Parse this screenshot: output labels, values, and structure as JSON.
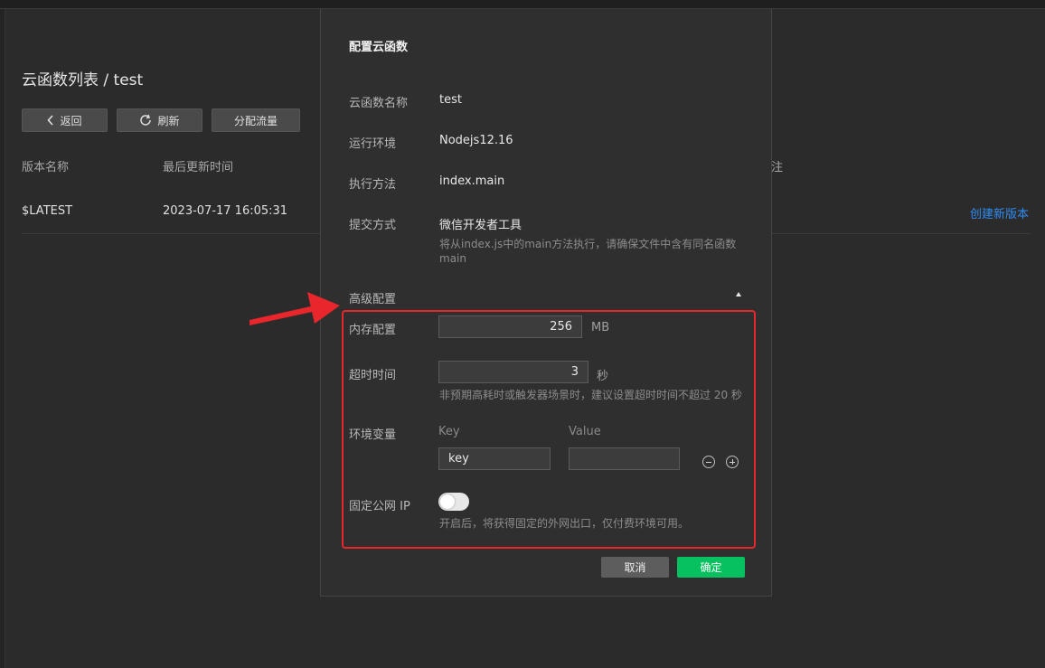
{
  "page": {
    "title": "云函数列表 / test",
    "buttons": {
      "back": "返回",
      "refresh": "刷新",
      "traffic": "分配流量"
    },
    "columns": [
      "版本名称",
      "最后更新时间",
      "注"
    ],
    "row": {
      "name": "$LATEST",
      "updated": "2023-07-17 16:05:31",
      "action": "创建新版本"
    }
  },
  "modal": {
    "title": "配置云函数",
    "fields": {
      "name_label": "云函数名称",
      "name_value": "test",
      "runtime_label": "运行环境",
      "runtime_value": "Nodejs12.16",
      "handler_label": "执行方法",
      "handler_value": "index.main",
      "submit_label": "提交方式",
      "submit_value": "微信开发者工具",
      "submit_hint_1": "将从index.js中的main方法执行，请确保文件中含有同名函数",
      "submit_hint_2": "main"
    },
    "advanced": {
      "label": "高级配置",
      "memory_label": "内存配置",
      "memory_value": "256",
      "memory_unit": "MB",
      "timeout_label": "超时时间",
      "timeout_value": "3",
      "timeout_unit": "秒",
      "timeout_hint": "非预期高耗时或触发器场景时，建议设置超时时间不超过 20 秒",
      "env_label": "环境变量",
      "env_key_header": "Key",
      "env_value_header": "Value",
      "env_key_value": "key",
      "env_value_value": "",
      "ip_label": "固定公网 IP",
      "ip_enabled": false,
      "ip_hint": "开启后，将获得固定的外网出口，仅付费环境可用。"
    },
    "cancel": "取消",
    "confirm": "确定"
  },
  "colors": {
    "accent": "#07c160",
    "link": "#2f8cf4",
    "highlight": "#e8262b"
  }
}
